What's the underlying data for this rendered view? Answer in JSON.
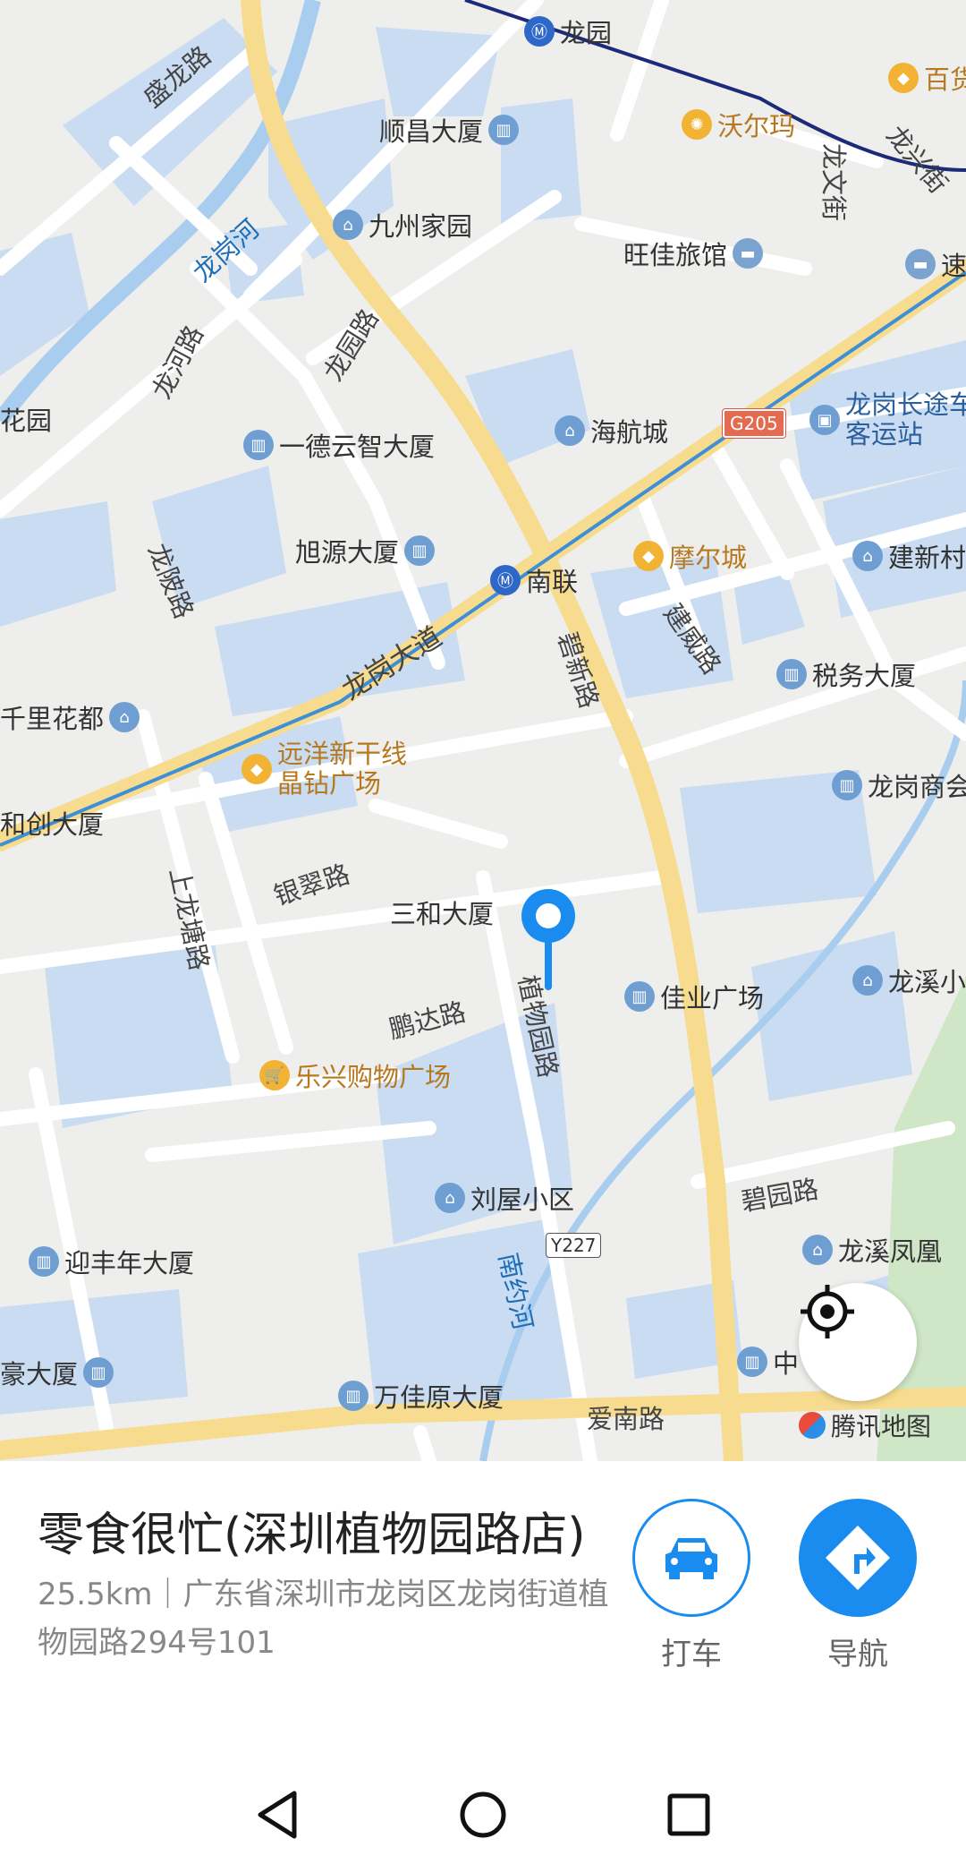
{
  "map": {
    "brand": "腾讯地图",
    "highway_badge": "G205",
    "county_badge": "Y227",
    "roads": {
      "longgang_avenue": "龙岗大道",
      "bixin_road": "碧新路",
      "jianwei_road": "建威路",
      "yincui_road": "银翠路",
      "pengda_road": "鹏达路",
      "zhiwuyuan_road": "植物园路",
      "biyuan_road": "碧园路",
      "ainan_road": "爱南路",
      "shanglongtang_road": "上龙塘路",
      "longpo_road": "龙陂路",
      "longhe_road": "龙河路",
      "longyuan_road": "龙园路",
      "shenglong_road": "盛龙路",
      "longwen_street": "龙文街",
      "longxing_street": "龙兴街",
      "longgang_river": "龙岗河",
      "nanyue_river": "南约河"
    },
    "pois": {
      "longyuan": "龙园",
      "baihuo": "百货",
      "walmart": "沃尔玛",
      "shunchang": "顺昌大厦",
      "jiuzhou": "九州家园",
      "wangjia": "旺佳旅馆",
      "su": "速",
      "huayuan": "花园",
      "yide": "一德云智大厦",
      "haihang": "海航城",
      "longgang_station": "龙岗长途车客运站",
      "xuyuan": "旭源大厦",
      "nanlian": "南联",
      "moer": "摩尔城",
      "jianxin": "建新村",
      "shuiwu": "税务大厦",
      "qianli": "千里花都",
      "yuanyang": "远洋新干线晶钻广场",
      "hechuang": "和创大厦",
      "longgang_shang": "龙岗商会",
      "sanhe": "三和大厦",
      "jiaye": "佳业广场",
      "longxi": "龙溪小",
      "lexing": "乐兴购物广场",
      "liuwu": "刘屋小区",
      "yingfengnian": "迎丰年大厦",
      "longxi_fenghuang": "龙溪凤凰",
      "zhong": "中",
      "left_bottom": "豪大厦",
      "wanjiayuan": "万佳原大厦"
    }
  },
  "place": {
    "name": "零食很忙(深圳植物园路店)",
    "address": "25.5km｜广东省深圳市龙岗区龙岗街道植物园路294号101"
  },
  "actions": {
    "taxi": "打车",
    "navigate": "导航"
  },
  "colors": {
    "accent": "#1a8cf0",
    "pin": "#1a8cf0",
    "metro_line": "#1c2a7a"
  }
}
